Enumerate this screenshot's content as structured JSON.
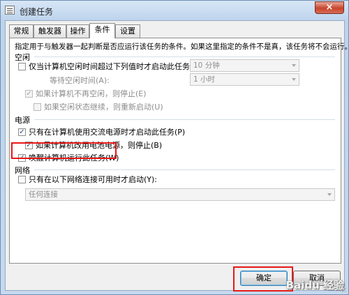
{
  "window": {
    "title": "创建任务",
    "close_glyph": "×"
  },
  "tabs": [
    {
      "label": "常规"
    },
    {
      "label": "触发器"
    },
    {
      "label": "操作"
    },
    {
      "label": "条件",
      "active": true
    },
    {
      "label": "设置"
    }
  ],
  "description": "指定用于与触发器一起判断是否应运行该任务的条件。如果这里指定的条件不是真，该任务将不会运行。",
  "idle": {
    "section": "空闲",
    "start_if_idle": {
      "label": "仅当计算机空闲时间超过下列值时才启动此任务(C):",
      "checked": false,
      "enabled": true
    },
    "idle_duration": {
      "value": "10 分钟",
      "enabled": false
    },
    "wait_idle": {
      "label": "等待空闲时间(A):",
      "value": "1 小时",
      "enabled": false
    },
    "stop_if_not_idle": {
      "label": "如果计算机不再空闲，则停止(E)",
      "checked": true,
      "enabled": false
    },
    "restart_if_idle": {
      "label": "如果空闲状态继续，则重新启动(U)",
      "checked": false,
      "enabled": false
    }
  },
  "power": {
    "section": "电源",
    "ac_only": {
      "label": "只有在计算机使用交流电源时才启动此任务(P)",
      "checked": true
    },
    "stop_on_battery": {
      "label": "如果计算机改用电池电源，则停止(B)",
      "checked": true
    },
    "wake_to_run": {
      "label": "唤醒计算机运行此任务(W)",
      "checked": true
    }
  },
  "network": {
    "section": "网络",
    "only_if_network": {
      "label": "只有在以下网络连接可用时才启动(Y):",
      "checked": false
    },
    "connection": {
      "value": "任何连接",
      "enabled": false
    }
  },
  "buttons": {
    "ok": "确定",
    "cancel": "取消"
  },
  "watermark": "Baidu 经验",
  "colors": {
    "highlight_box": "#e8181a",
    "check": "#2d4f84"
  }
}
